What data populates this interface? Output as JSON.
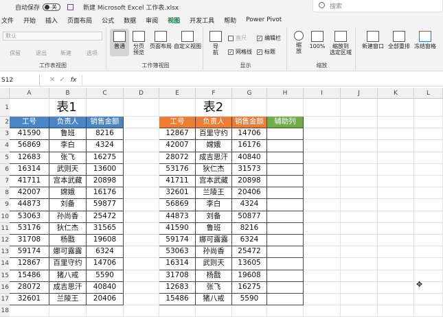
{
  "titlebar": {
    "autosave": "自动保存",
    "toggle": "关",
    "filename": "新建 Microsoft Excel 工作表.xlsx",
    "search": "搜索"
  },
  "menu": [
    "文件",
    "开始",
    "插入",
    "页面布局",
    "公式",
    "数据",
    "审阅",
    "视图",
    "开发工具",
    "帮助",
    "Power Pivot"
  ],
  "ribbon": {
    "sheetview": {
      "default": "默认",
      "keep": "保留",
      "exit": "退出",
      "new": "新建",
      "options": "选项",
      "label": "工作表视图"
    },
    "workbook": {
      "normal": "普通",
      "pagebreak": "分页\n预览",
      "pagelayout": "页面布局",
      "custom": "自定义视图",
      "label": "工作簿视图"
    },
    "show": {
      "nav": "导\n航",
      "ruler": "直尺",
      "gridlines": "网格线",
      "formulabar": "编辑栏",
      "headings": "标题",
      "label": "显示"
    },
    "zoom": {
      "zoom": "缩\n放",
      "z100": "100%",
      "selection": "缩放到\n选定区域",
      "label": "缩放"
    },
    "window": {
      "newwin": "新建窗口",
      "arrange": "全部重排",
      "freeze": "冻结窗格"
    }
  },
  "formula": {
    "namebox": "S12",
    "fx": "fx"
  },
  "columns": [
    "A",
    "B",
    "C",
    "D",
    "E",
    "F",
    "G",
    "H",
    "I",
    "J",
    "K",
    "L"
  ],
  "rows": [
    "1",
    "2",
    "3",
    "4",
    "5",
    "6",
    "7",
    "8",
    "9",
    "10",
    "11",
    "12",
    "13",
    "14",
    "15",
    "16",
    "17",
    "18"
  ],
  "table1": {
    "title": "表1",
    "headers": [
      "工号",
      "负责人",
      "销售金额"
    ],
    "rows": [
      [
        "41590",
        "鲁班",
        "8216"
      ],
      [
        "56869",
        "李白",
        "4324"
      ],
      [
        "12683",
        "张飞",
        "16275"
      ],
      [
        "16314",
        "武则天",
        "13600"
      ],
      [
        "41711",
        "宫本武藏",
        "20898"
      ],
      [
        "42007",
        "嫦娥",
        "16176"
      ],
      [
        "44873",
        "刘备",
        "59877"
      ],
      [
        "53063",
        "孙尚香",
        "25472"
      ],
      [
        "53176",
        "狄仁杰",
        "31565"
      ],
      [
        "31708",
        "杨戬",
        "19608"
      ],
      [
        "59174",
        "娜可露露",
        "6324"
      ],
      [
        "12867",
        "百里守约",
        "14706"
      ],
      [
        "15486",
        "猪八戒",
        "5590"
      ],
      [
        "28072",
        "成吉思汗",
        "40840"
      ],
      [
        "32601",
        "兰陵王",
        "20406"
      ]
    ]
  },
  "table2": {
    "title": "表2",
    "headers": [
      "工号",
      "负责人",
      "销售金额",
      "辅助列"
    ],
    "rows": [
      [
        "12867",
        "百里守约",
        "14706",
        ""
      ],
      [
        "42007",
        "嫦娥",
        "16176",
        ""
      ],
      [
        "28072",
        "成吉思汗",
        "40840",
        ""
      ],
      [
        "53176",
        "狄仁杰",
        "31573",
        ""
      ],
      [
        "41711",
        "宫本武藏",
        "20898",
        ""
      ],
      [
        "32601",
        "兰陵王",
        "20406",
        ""
      ],
      [
        "56869",
        "李白",
        "4324",
        ""
      ],
      [
        "44873",
        "刘备",
        "50877",
        ""
      ],
      [
        "41590",
        "鲁班",
        "8216",
        ""
      ],
      [
        "59174",
        "娜可露露",
        "6324",
        ""
      ],
      [
        "53063",
        "孙尚香",
        "25472",
        ""
      ],
      [
        "16314",
        "武则天",
        "13605",
        ""
      ],
      [
        "31708",
        "杨戬",
        "19608",
        ""
      ],
      [
        "12683",
        "张飞",
        "16275",
        ""
      ],
      [
        "15486",
        "猪八戒",
        "5590",
        ""
      ]
    ]
  },
  "colors": {
    "blue": "#4a86c5",
    "orange": "#ed7d31",
    "green": "#70ad47",
    "accent": "#107c41"
  }
}
